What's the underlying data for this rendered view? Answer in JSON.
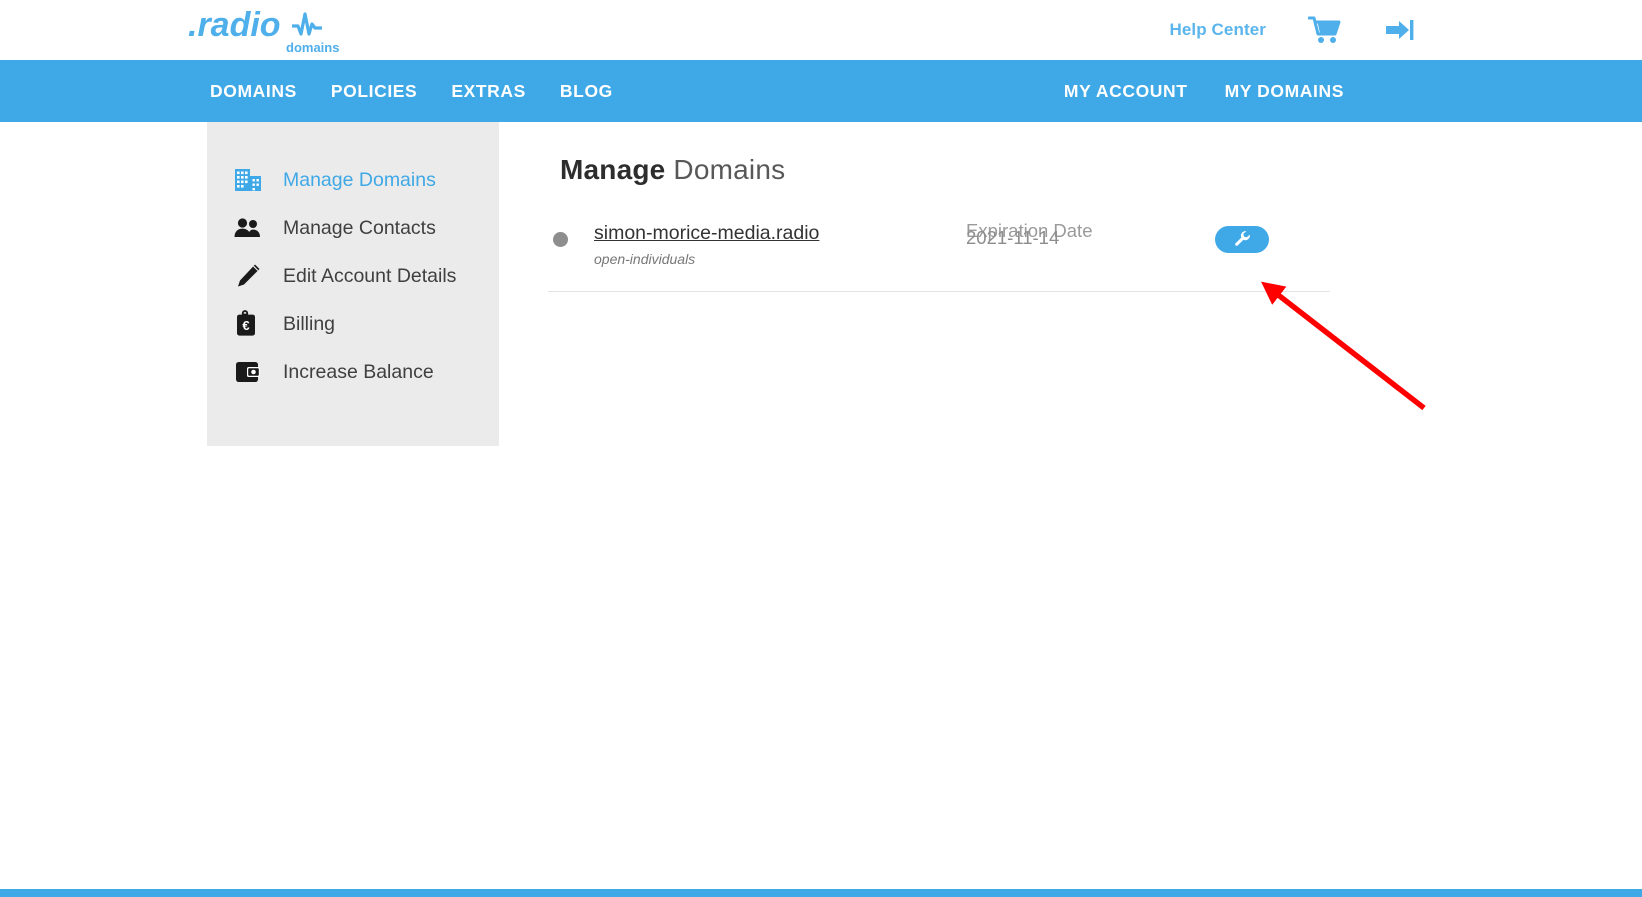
{
  "brand": {
    "logo_text": ".radio",
    "logo_sub": "domains",
    "accent_color": "#3FA8E6",
    "help_link_color": "#5BB5EC"
  },
  "header": {
    "help_center": "Help Center",
    "cart_icon": "shopping-cart-icon",
    "login_icon": "sign-in-icon"
  },
  "navbar": {
    "left_items": [
      {
        "label": "DOMAINS"
      },
      {
        "label": "POLICIES"
      },
      {
        "label": "EXTRAS"
      },
      {
        "label": "BLOG"
      }
    ],
    "right_items": [
      {
        "label": "MY ACCOUNT"
      },
      {
        "label": "MY DOMAINS"
      }
    ]
  },
  "sidebar": {
    "items": [
      {
        "label": "Manage Domains",
        "icon": "building-icon",
        "active": true
      },
      {
        "label": "Manage Contacts",
        "icon": "people-icon",
        "active": false
      },
      {
        "label": "Edit Account Details",
        "icon": "pencil-icon",
        "active": false
      },
      {
        "label": "Billing",
        "icon": "euro-tag-icon",
        "active": false
      },
      {
        "label": "Increase Balance",
        "icon": "wallet-icon",
        "active": false
      }
    ]
  },
  "main": {
    "title_bold": "Manage",
    "title_light": " Domains",
    "table": {
      "headers": {
        "expiration": "Expiration Date"
      },
      "rows": [
        {
          "status": "active",
          "domain": "simon-morice-media.radio",
          "category": "open-individuals",
          "expiration_date": "2021-11-14",
          "action_icon": "wrench-icon"
        }
      ]
    }
  },
  "annotation": {
    "type": "arrow",
    "color": "#FF0000",
    "target": "manage-domain-wrench-button"
  }
}
